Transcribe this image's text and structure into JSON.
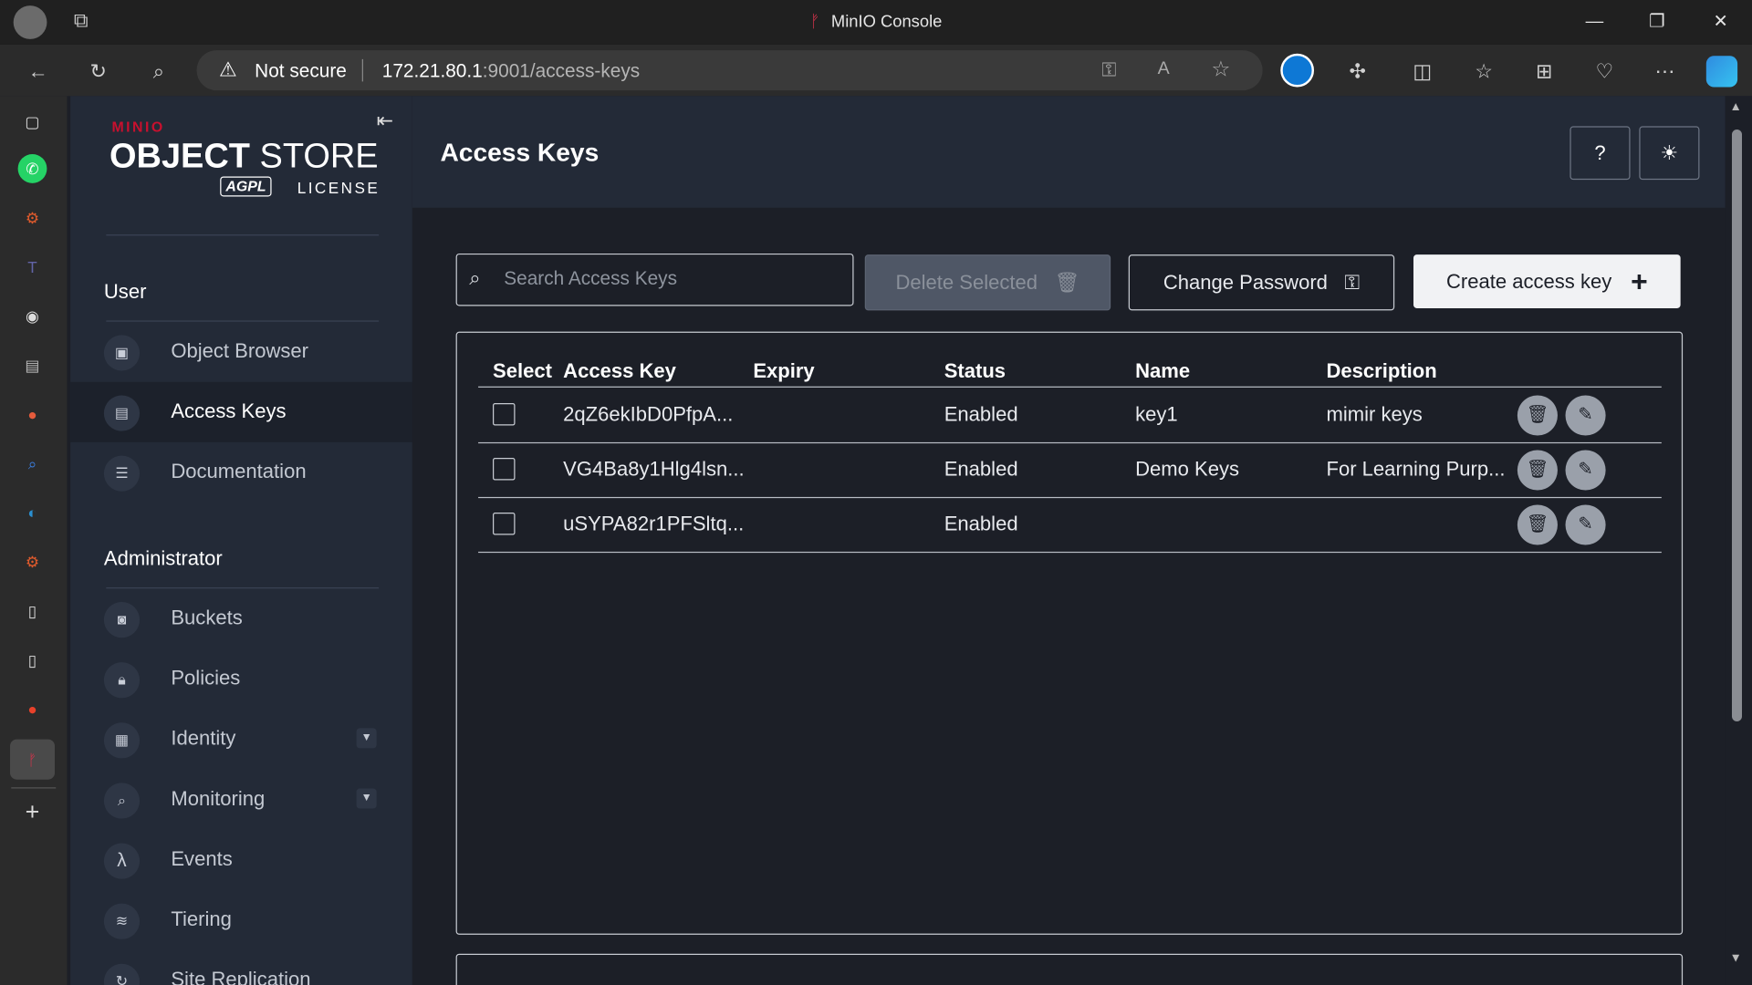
{
  "browser": {
    "window_title": "MinIO Console",
    "security_label": "Not secure",
    "url_host": "172.21.80.1",
    "url_path": ":9001/access-keys"
  },
  "logo": {
    "brand": "MINIO",
    "product_bold": "OBJECT",
    "product_light": " STORE",
    "badge": "AGPL",
    "license": "LICENSE"
  },
  "sidebar": {
    "user_section": "User",
    "user_items": [
      {
        "label": "Object Browser",
        "icon": "object-browser-icon"
      },
      {
        "label": "Access Keys",
        "icon": "access-keys-icon",
        "active": true
      },
      {
        "label": "Documentation",
        "icon": "documentation-icon"
      }
    ],
    "admin_section": "Administrator",
    "admin_items": [
      {
        "label": "Buckets",
        "icon": "bucket-icon"
      },
      {
        "label": "Policies",
        "icon": "policy-icon"
      },
      {
        "label": "Identity",
        "icon": "identity-icon",
        "expandable": true
      },
      {
        "label": "Monitoring",
        "icon": "monitoring-icon",
        "expandable": true
      },
      {
        "label": "Events",
        "icon": "lambda-icon"
      },
      {
        "label": "Tiering",
        "icon": "tiering-icon"
      },
      {
        "label": "Site Replication",
        "icon": "replication-icon"
      }
    ]
  },
  "page": {
    "title": "Access Keys",
    "search_placeholder": "Search Access Keys",
    "delete_selected": "Delete Selected",
    "change_password": "Change Password",
    "create_access_key": "Create access key"
  },
  "table": {
    "columns": [
      "Select",
      "Access Key",
      "Expiry",
      "Status",
      "Name",
      "Description"
    ],
    "rows": [
      {
        "access_key": "2qZ6ekIbD0PfpA...",
        "expiry": "",
        "status": "Enabled",
        "name": "key1",
        "description": "mimir keys"
      },
      {
        "access_key": "VG4Ba8y1Hlg4lsn...",
        "expiry": "",
        "status": "Enabled",
        "name": "Demo Keys",
        "description": "For Learning Purp..."
      },
      {
        "access_key": "uSYPA82r1PFSltq...",
        "expiry": "",
        "status": "Enabled",
        "name": "",
        "description": ""
      }
    ]
  },
  "colors": {
    "sidebar_bg": "#232a37",
    "main_bg": "#1c1f27",
    "brand_red": "#c8102e"
  }
}
